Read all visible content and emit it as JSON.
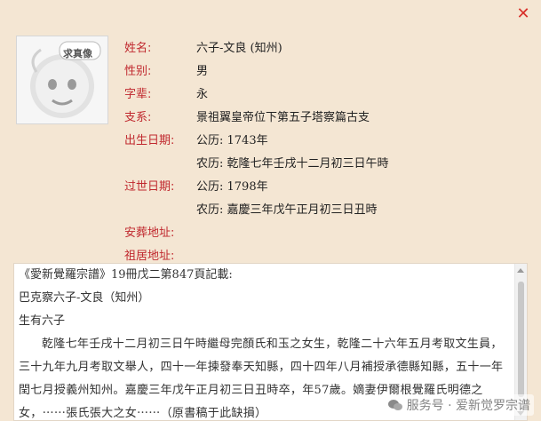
{
  "avatar": {
    "badge_text": "求真像",
    "icon": "placeholder-avatar-icon"
  },
  "close_icon": "close-icon",
  "fields": [
    {
      "label": "姓名:",
      "value": "六子-文良 (知州)"
    },
    {
      "label": "性别:",
      "value": "男"
    },
    {
      "label": "字辈:",
      "value": "永"
    },
    {
      "label": "支系:",
      "value": "景祖翼皇帝位下第五子塔察篇古支"
    },
    {
      "label": "出生日期:",
      "value": "公历: 1743年"
    },
    {
      "label": "",
      "value": "农历: 乾隆七年壬戌十二月初三日午時"
    },
    {
      "label": "过世日期:",
      "value": "公历: 1798年"
    },
    {
      "label": "",
      "value": "农历: 嘉慶三年戊午正月初三日丑時"
    },
    {
      "label": "安葬地址:",
      "value": ""
    },
    {
      "label": "祖居地址:",
      "value": ""
    }
  ],
  "doc": {
    "lines": [
      "《愛新覺羅宗譜》19冊戊二第847頁記載:",
      "巴克察六子-文良（知州）",
      "生有六子"
    ],
    "paragraph": "乾隆七年壬戌十二月初三日午時繼母完顏氏和玉之女生，乾隆二十六年五月考取文生員，三十九年九月考取文舉人，四十一年揀發奉天知縣，四十四年八月補授承德縣知縣，五十一年閏七月授義州知州。嘉慶三年戊午正月初三日丑時卒，年57歲。嫡妻伊爾根覺羅氏明德之女，⋯⋯張氏張大之女⋯⋯（原書稿于此缺損）"
  },
  "watermark": {
    "text": "服务号 · 爱新觉罗宗谱",
    "icon": "wechat-icon"
  },
  "colors": {
    "background": "#f4e6d3",
    "label": "#c0282e",
    "close": "#d8302a"
  }
}
